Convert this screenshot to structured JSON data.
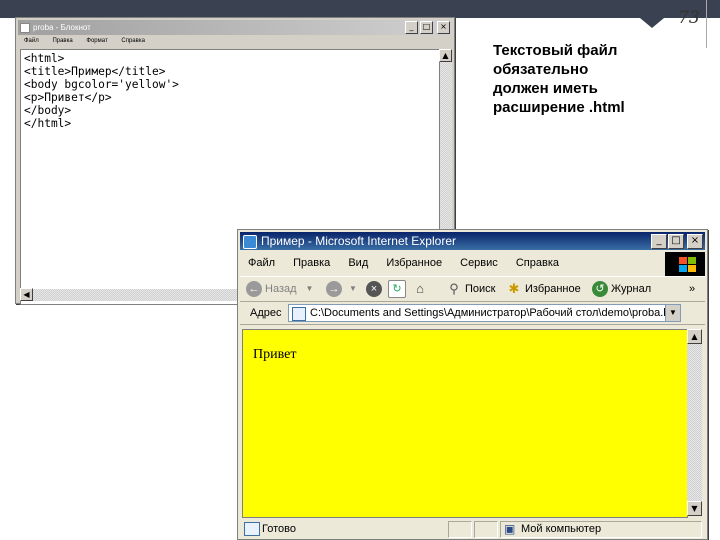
{
  "slide": {
    "number": "73",
    "text_lines": [
      "Текстовый файл",
      "обязательно",
      "должен иметь",
      "расширение .html"
    ]
  },
  "notepad": {
    "title": "proba - Блокнот",
    "menu": [
      "Файл",
      "Правка",
      "Формат",
      "Справка"
    ],
    "code": "<html>\n<title>Пример</title>\n<body bgcolor='yellow'>\n<p>Привет</p>\n</body>\n</html>"
  },
  "ie": {
    "title": "Пример - Microsoft Internet Explorer",
    "menu": [
      "Файл",
      "Правка",
      "Вид",
      "Избранное",
      "Сервис",
      "Справка"
    ],
    "toolbar": {
      "back": "Назад",
      "search": "Поиск",
      "favorites": "Избранное",
      "history": "Журнал",
      "more": "»"
    },
    "address_label": "Адрес",
    "address_value": "C:\\Documents and Settings\\Администратор\\Рабочий стол\\demo\\proba.html",
    "page_text": "Привет",
    "status": {
      "left": "Готово",
      "zone": "Мой компьютер"
    }
  },
  "colors": {
    "page_background": "#ffff00",
    "titlebar_active": "#0a246a",
    "window_face": "#ece9d8"
  }
}
